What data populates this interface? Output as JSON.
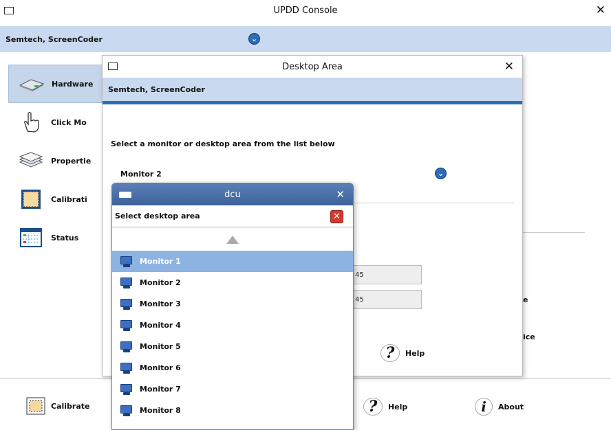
{
  "console": {
    "title": "UPDD Console",
    "device": "Semtech, ScreenCoder",
    "sidebar": [
      {
        "label": "Hardware",
        "icon": "hardware-icon"
      },
      {
        "label": "Click Mo",
        "icon": "hand-pointer-icon"
      },
      {
        "label": "Propertie",
        "icon": "layers-icon"
      },
      {
        "label": "Calibrati",
        "icon": "calibrate-icon"
      },
      {
        "label": "Status",
        "icon": "status-grid-icon"
      }
    ],
    "right_labels": [
      "e",
      "ice"
    ],
    "bottom": {
      "calibrate": "Calibrate",
      "help": "Help",
      "about": "About"
    }
  },
  "desktop_area": {
    "title": "Desktop Area",
    "device": "Semtech, ScreenCoder",
    "instruction": "Select a monitor or desktop area from the list below",
    "selected": "Monitor 2",
    "field1": "45",
    "field2": "45",
    "help": "Help"
  },
  "dcu": {
    "title": "dcu",
    "prompt": "Select desktop area",
    "monitors": [
      "Monitor 1",
      "Monitor 2",
      "Monitor 3",
      "Monitor 4",
      "Monitor 5",
      "Monitor 6",
      "Monitor 7",
      "Monitor 8"
    ],
    "selected_index": 0
  },
  "colors": {
    "accent": "#2d6db8",
    "band": "#c9d9ef",
    "selection": "#8db3e2",
    "close_red": "#d63a2f"
  }
}
